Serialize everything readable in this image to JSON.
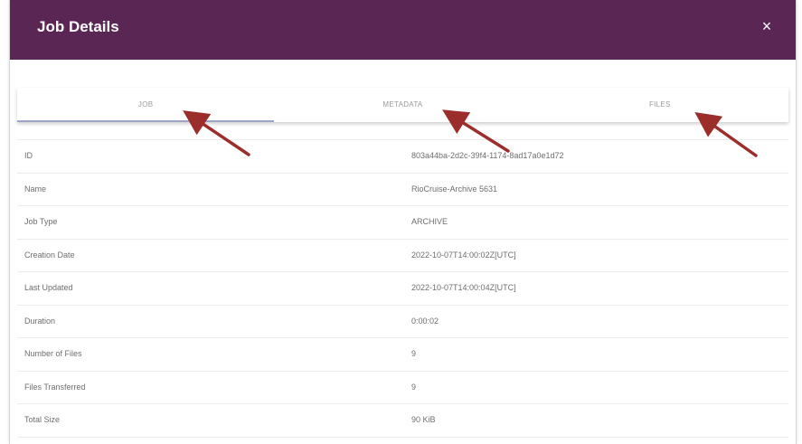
{
  "header": {
    "title": "Job Details",
    "close_label": "×"
  },
  "tabs": [
    {
      "label": "JOB",
      "active": true
    },
    {
      "label": "METADATA",
      "active": false
    },
    {
      "label": "FILES",
      "active": false
    }
  ],
  "details": [
    {
      "label": "ID",
      "value": "803a44ba-2d2c-39f4-1174-8ad17a0e1d72"
    },
    {
      "label": "Name",
      "value": "RioCruise-Archive 5631"
    },
    {
      "label": "Job Type",
      "value": "ARCHIVE"
    },
    {
      "label": "Creation Date",
      "value": "2022-10-07T14:00:02Z[UTC]"
    },
    {
      "label": "Last Updated",
      "value": "2022-10-07T14:00:04Z[UTC]"
    },
    {
      "label": "Duration",
      "value": "0:00:02"
    },
    {
      "label": "Number of Files",
      "value": "9"
    },
    {
      "label": "Files Transferred",
      "value": "9"
    },
    {
      "label": "Total Size",
      "value": "90 KiB"
    }
  ],
  "colors": {
    "header_bg": "#5a2755",
    "arrow": "#9b2e2b",
    "tab_indicator": "#9ba6c4"
  }
}
